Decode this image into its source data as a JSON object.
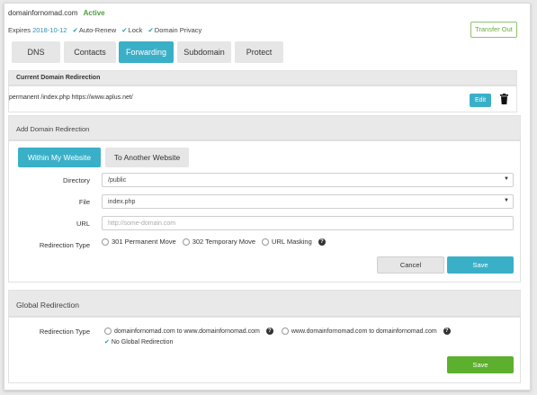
{
  "header": {
    "domain": "domainfornomad.com",
    "status": "Active",
    "expires_label": "Expires",
    "expires_date": "2018-10-12",
    "features": [
      "Auto-Renew",
      "Lock",
      "Domain Privacy"
    ],
    "transfer_label": "Transfer Out"
  },
  "tabs": [
    "DNS",
    "Contacts",
    "Forwarding",
    "Subdomain",
    "Protect"
  ],
  "active_tab": "Forwarding",
  "current": {
    "title": "Current Domain Redirection",
    "entry": "permanent /index.php https://www.aplus.net/",
    "edit_label": "Edit"
  },
  "add": {
    "title": "Add Domain Redirection",
    "subtabs": [
      "Within My Website",
      "To Another Website"
    ],
    "directory_label": "Directory",
    "directory_value": "/public",
    "file_label": "File",
    "file_value": "index.php",
    "url_label": "URL",
    "url_placeholder": "http://some-domain.com",
    "type_label": "Redirection Type",
    "types": [
      "301 Permanent Move",
      "302 Temporary Move",
      "URL Masking"
    ],
    "cancel_label": "Cancel",
    "save_label": "Save"
  },
  "global": {
    "title": "Global Redirection",
    "type_label": "Redirection Type",
    "options": [
      "domainfornomad.com to www.domainfornomad.com",
      "www.domainfornomad.com to domainfornomad.com"
    ],
    "selected": "No Global Redirection",
    "save_label": "Save"
  },
  "colors": {
    "accent": "#3ab0c8",
    "success": "#5cb02d",
    "active_text": "#4a9f3c"
  }
}
